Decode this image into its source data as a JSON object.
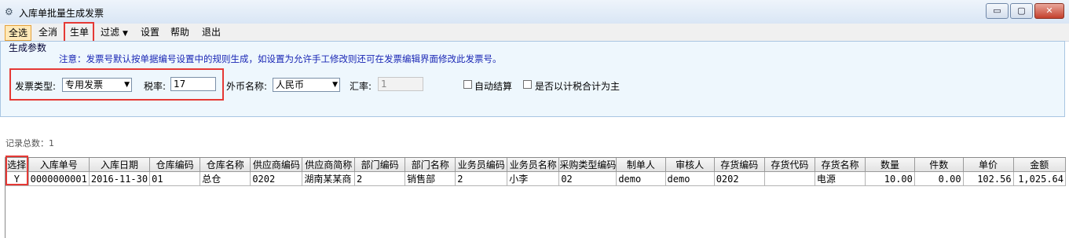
{
  "window": {
    "title": "入库单批量生成发票",
    "min": "▭",
    "max": "▢",
    "close": "✕"
  },
  "toolbar": {
    "select_all": "全选",
    "clear_all": "全消",
    "generate": "生单",
    "filter": "过滤",
    "settings": "设置",
    "help": "帮助",
    "exit": "退出"
  },
  "params": {
    "legend": "生成参数",
    "note": "注意：发票号默认按单据编号设置中的规则生成，如设置为允许手工修改则还可在发票编辑界面修改此发票号。",
    "invoice_type_label": "发票类型:",
    "invoice_type_value": "专用发票",
    "tax_rate_label": "税率:",
    "tax_rate_value": "17",
    "currency_label": "外币名称:",
    "currency_value": "人民币",
    "exchange_rate_label": "汇率:",
    "exchange_rate_value": "1",
    "auto_settle_label": "自动结算",
    "tax_inclusive_label": "是否以计税合计为主"
  },
  "record_count": "记录总数：1",
  "table": {
    "columns": [
      "选择",
      "入库单号",
      "入库日期",
      "仓库编码",
      "仓库名称",
      "供应商编码",
      "供应商简称",
      "部门编码",
      "部门名称",
      "业务员编码",
      "业务员名称",
      "采购类型编码",
      "制单人",
      "审核人",
      "存货编码",
      "存货代码",
      "存货名称",
      "数量",
      "件数",
      "单价",
      "金额"
    ],
    "rows": [
      [
        "Y",
        "0000000001",
        "2016-11-30",
        "01",
        "总仓",
        "0202",
        "湖南某某商",
        "2",
        "销售部",
        "2",
        "小李",
        "02",
        "demo",
        "demo",
        "0202",
        "",
        "电源",
        "10.00",
        "0.00",
        "102.56",
        "1,025.64"
      ]
    ]
  },
  "colors": {
    "highlight_box": "#e53935",
    "note_text": "#1a27b5",
    "panel_bg": "#eef7fd"
  }
}
